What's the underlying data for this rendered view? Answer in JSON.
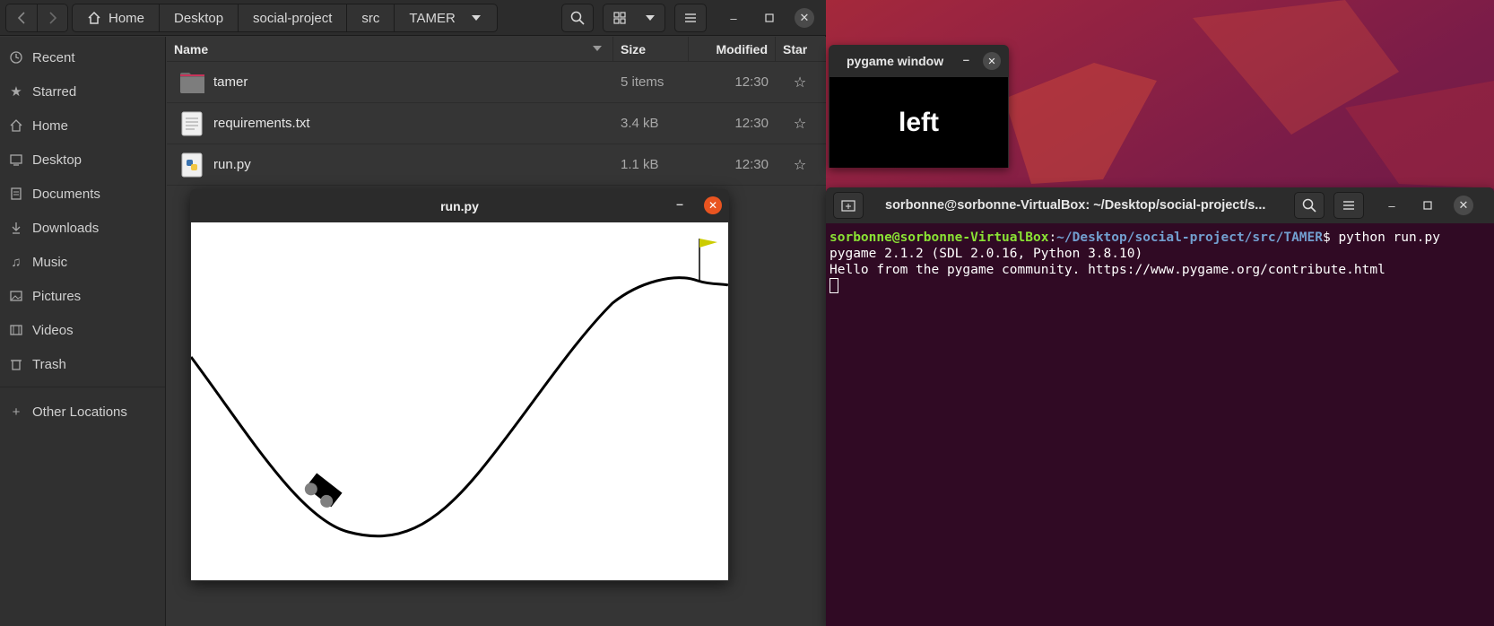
{
  "files": {
    "breadcrumbs": [
      "Home",
      "Desktop",
      "social-project",
      "src",
      "TAMER"
    ],
    "sidebar": [
      {
        "label": "Recent",
        "icon": "clock-icon"
      },
      {
        "label": "Starred",
        "icon": "star-icon"
      },
      {
        "label": "Home",
        "icon": "home-icon"
      },
      {
        "label": "Desktop",
        "icon": "desktop-icon"
      },
      {
        "label": "Documents",
        "icon": "document-icon"
      },
      {
        "label": "Downloads",
        "icon": "download-icon"
      },
      {
        "label": "Music",
        "icon": "music-icon"
      },
      {
        "label": "Pictures",
        "icon": "picture-icon"
      },
      {
        "label": "Videos",
        "icon": "video-icon"
      },
      {
        "label": "Trash",
        "icon": "trash-icon"
      }
    ],
    "other_locations": "Other Locations",
    "columns": {
      "name": "Name",
      "size": "Size",
      "modified": "Modified",
      "star": "Star"
    },
    "rows": [
      {
        "name": "tamer",
        "size": "5 items",
        "modified": "12:30",
        "icon": "folder-icon"
      },
      {
        "name": "requirements.txt",
        "size": "3.4 kB",
        "modified": "12:30",
        "icon": "text-file-icon"
      },
      {
        "name": "run.py",
        "size": "1.1 kB",
        "modified": "12:30",
        "icon": "python-file-icon"
      }
    ]
  },
  "game_window": {
    "title": "run.py"
  },
  "pygame_window": {
    "title": "pygame window",
    "action_text": "left"
  },
  "terminal": {
    "title": "sorbonne@sorbonne-VirtualBox: ~/Desktop/social-project/s...",
    "prompt_user": "sorbonne@sorbonne-VirtualBox",
    "prompt_sep": ":",
    "prompt_path": "~/Desktop/social-project/src/TAMER",
    "command": "$ python run.py",
    "output": [
      "pygame 2.1.2 (SDL 2.0.16, Python 3.8.10)",
      "Hello from the pygame community. https://www.pygame.org/contribute.html"
    ]
  },
  "colors": {
    "accent": "#e95420",
    "terminal_bg": "#300a24",
    "prompt_user": "#8ae234",
    "prompt_path": "#729fcf"
  }
}
